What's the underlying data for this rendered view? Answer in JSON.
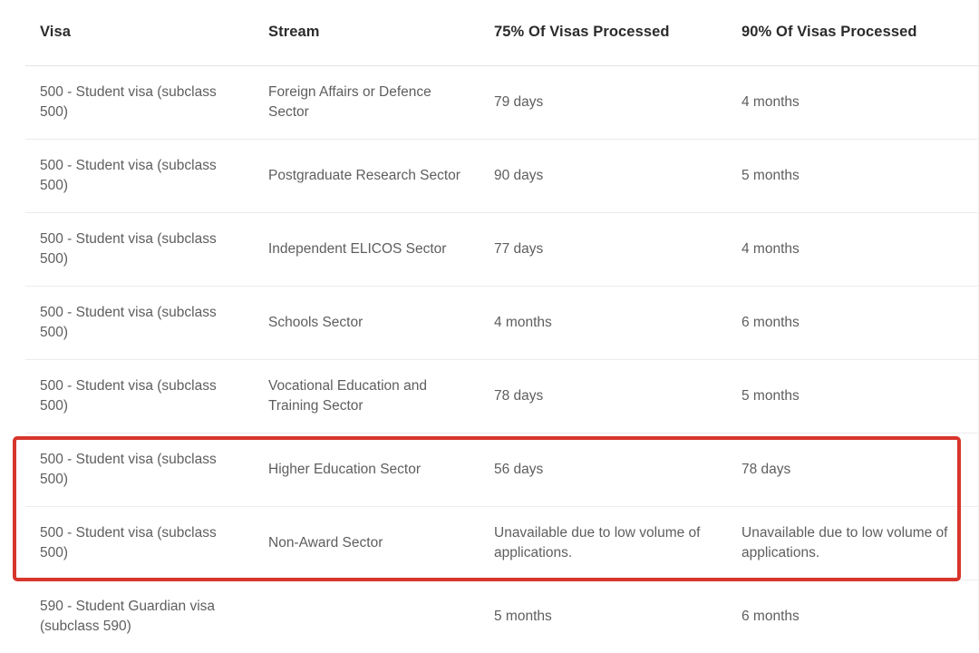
{
  "table": {
    "columns": [
      {
        "key": "visa",
        "label": "Visa"
      },
      {
        "key": "stream",
        "label": "Stream"
      },
      {
        "key": "p75",
        "label": "75% Of Visas Processed"
      },
      {
        "key": "p90",
        "label": "90% Of Visas Processed"
      }
    ],
    "rows": [
      {
        "visa": "500 - Student visa (subclass 500)",
        "stream": "Foreign Affairs or Defence Sector",
        "p75": "79 days",
        "p90": "4 months"
      },
      {
        "visa": "500 - Student visa (subclass 500)",
        "stream": "Postgraduate Research Sector",
        "p75": "90 days",
        "p90": "5 months"
      },
      {
        "visa": "500 - Student visa (subclass 500)",
        "stream": "Independent ELICOS Sector",
        "p75": "77 days",
        "p90": "4 months"
      },
      {
        "visa": "500 - Student visa (subclass 500)",
        "stream": "Schools Sector",
        "p75": "4 months",
        "p90": "6 months"
      },
      {
        "visa": "500 - Student visa (subclass 500)",
        "stream": "Vocational Education and Training Sector",
        "p75": "78 days",
        "p90": "5 months"
      },
      {
        "visa": "500 - Student visa (subclass 500)",
        "stream": "Higher Education Sector",
        "p75": "56 days",
        "p90": "78 days"
      },
      {
        "visa": "500 - Student visa (subclass 500)",
        "stream": "Non-Award Sector",
        "p75": "Unavailable due to low volume of applications.",
        "p90": "Unavailable due to low volume of applications."
      },
      {
        "visa": "590 - Student Guardian visa (subclass 590)",
        "stream": "",
        "p75": "5 months",
        "p90": "6 months"
      }
    ]
  },
  "annotation": {
    "type": "rectangle-highlight",
    "color": "#d8352c",
    "covers_rows": [
      "500 - Student visa (subclass 500) / Higher Education Sector",
      "500 - Student visa (subclass 500) / Non-Award Sector"
    ]
  },
  "colors": {
    "header_text": "#2b2b2b",
    "body_text": "#5e5e5e",
    "row_divider": "#ececec",
    "header_divider": "#e3e3e3",
    "highlight": "#d8352c",
    "background": "#ffffff"
  }
}
